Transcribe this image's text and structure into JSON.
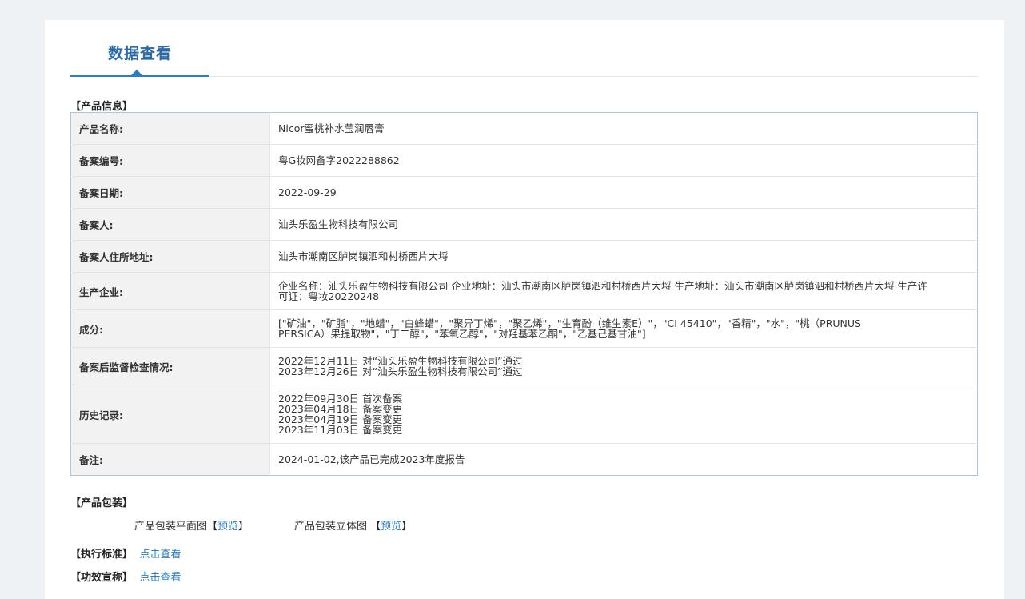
{
  "tabs": [
    {
      "label": "数据查看"
    }
  ],
  "sections": {
    "product_info": "【产品信息】",
    "packaging": "【产品包装】",
    "standard": "【执行标准】",
    "efficacy": "【功效宣称】"
  },
  "product_info": [
    {
      "key": "产品名称:",
      "value": "Nicor蜜桃补水莹润唇膏"
    },
    {
      "key": "备案编号:",
      "value": "粤G妆网备字2022288862"
    },
    {
      "key": "备案日期:",
      "value": "2022-09-29"
    },
    {
      "key": "备案人:",
      "value": "汕头乐盈生物科技有限公司"
    },
    {
      "key": "备案人住所地址:",
      "value": "汕头市潮南区胪岗镇泗和村桥西片大埒"
    },
    {
      "key": "生产企业:",
      "value": "企业名称：汕头乐盈生物科技有限公司 企业地址：汕头市潮南区胪岗镇泗和村桥西片大埒 生产地址：汕头市潮南区胪岗镇泗和村桥西片大埒 生产许可证：粤妆20220248"
    },
    {
      "key": "成分:",
      "value": "[\"矿油\"，\"矿脂\"，\"地蜡\"，\"白蜂蜡\"，\"聚异丁烯\"，\"聚乙烯\"，\"生育酚（维生素E）\"，\"CI 45410\"，\"香精\"，\"水\"，\"桃（PRUNUS PERSICA）果提取物\"，\"丁二醇\"，\"苯氧乙醇\"，\"对羟基苯乙酮\"，\"乙基己基甘油\"]"
    },
    {
      "key": "备案后监督检查情况:",
      "lines": [
        "2022年12月11日 对“汕头乐盈生物科技有限公司”通过",
        "2023年12月26日 对“汕头乐盈生物科技有限公司”通过"
      ]
    },
    {
      "key": "历史记录:",
      "lines": [
        "2022年09月30日 首次备案",
        "2023年04月18日 备案变更",
        "2023年04月19日 备案变更",
        "2023年11月03日 备案变更"
      ]
    },
    {
      "key": "备注:",
      "value": "2024-01-02,该产品已完成2023年度报告"
    }
  ],
  "packaging": {
    "flat_label": "产品包装平面图",
    "solid_label": "产品包装立体图",
    "preview_link": "预览",
    "bracket_open": "【",
    "bracket_close": "】"
  },
  "standard_link": "点击查看",
  "efficacy_link": "点击查看"
}
